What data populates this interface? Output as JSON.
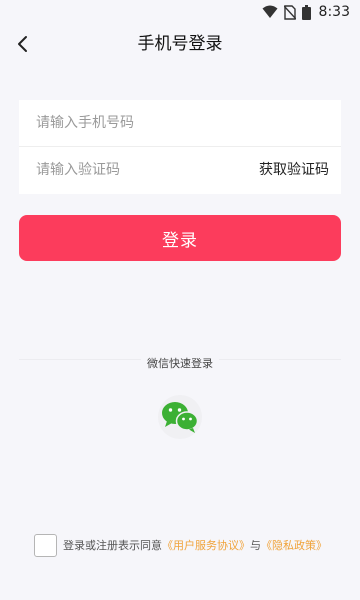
{
  "status_bar": {
    "time": "8:33",
    "icons": [
      "wifi-icon",
      "no-sim-icon",
      "battery-icon"
    ]
  },
  "header": {
    "title": "手机号登录",
    "back_icon": "back-chevron-icon"
  },
  "form": {
    "phone_placeholder": "请输入手机号码",
    "phone_value": "",
    "code_placeholder": "请输入验证码",
    "code_value": "",
    "get_code_label": "获取验证码"
  },
  "login_button": {
    "label": "登录",
    "color": "#fc3c5c"
  },
  "wechat": {
    "label": "微信快速登录",
    "icon": "wechat-icon",
    "color": "#3cb034"
  },
  "agreement": {
    "checked": false,
    "prefix": "登录或注册表示同意",
    "user_agreement": "《用户服务协议》",
    "connector": "与",
    "privacy_policy": "《隐私政策》",
    "link_color": "#f0a33a"
  }
}
